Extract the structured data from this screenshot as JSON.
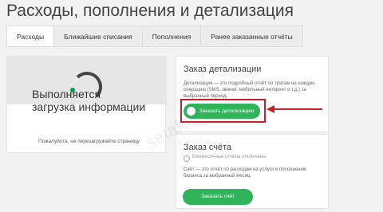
{
  "page": {
    "title": "Расходы, пополнения и детализация"
  },
  "tabs": [
    {
      "label": "Расходы",
      "active": true
    },
    {
      "label": "Ближайшие списания",
      "active": false
    },
    {
      "label": "Пополнения",
      "active": false
    },
    {
      "label": "Ранее заказанные отчёты",
      "active": false
    }
  ],
  "loading": {
    "title_line1": "Выполняется",
    "title_line2": "загрузка информации",
    "subtitle": "Пожалуйста, не перезагружайте страницу"
  },
  "detail": {
    "title": "Заказ детализации",
    "description": "Детализация — это подробный отчёт по тратам на каждую операцию (SMS, звонки, мобильный интернет и т.д.) за выбранный период.",
    "button": "Заказать детализацию"
  },
  "invoice": {
    "title": "Заказ счёта",
    "checkbox_label": "Ежемесячные отчёты отключены",
    "description": "Счёт — это отчёт по расходам на услуги и пополнению баланса за выбранный месяц.",
    "button": "Заказать счёт"
  },
  "colors": {
    "accent": "#2fb45a",
    "highlight": "#c8202a",
    "spinner_dot": "#00a34b"
  },
  "watermark": "setafon"
}
